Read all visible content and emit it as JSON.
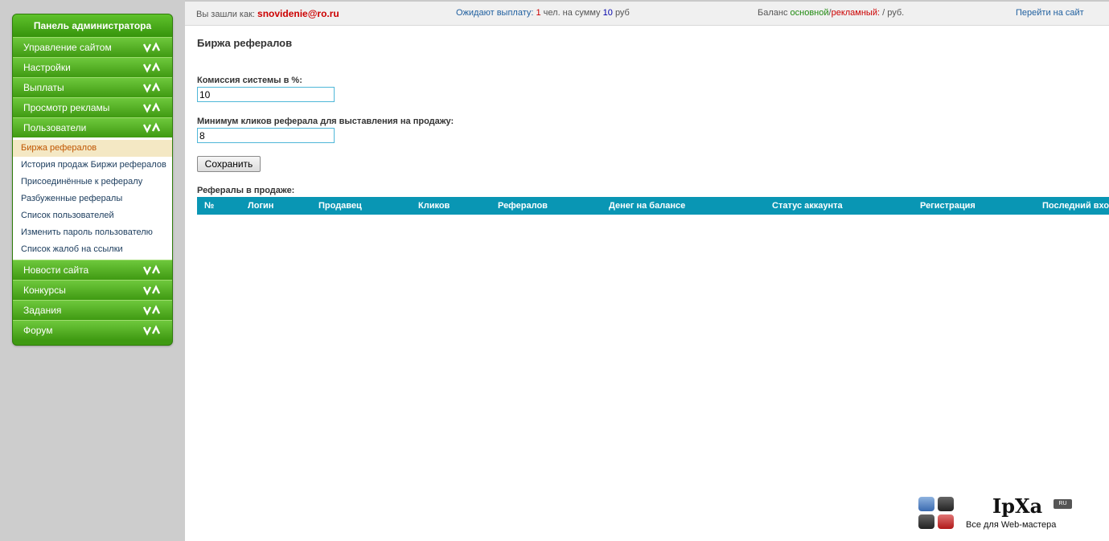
{
  "sidebar": {
    "title": "Панель администратора",
    "sections_top": [
      {
        "label": "Управление сайтом"
      },
      {
        "label": "Настройки"
      },
      {
        "label": "Выплаты"
      },
      {
        "label": "Просмотр рекламы"
      },
      {
        "label": "Пользователи"
      }
    ],
    "sub_items": [
      {
        "label": "Биржа рефералов",
        "active": true
      },
      {
        "label": "История продаж Биржи рефералов"
      },
      {
        "label": "Присоединённые к рефералу"
      },
      {
        "label": "Разбуженные рефералы"
      },
      {
        "label": "Список пользователей"
      },
      {
        "label": "Изменить пароль пользователю"
      },
      {
        "label": "Список жалоб на ссылки"
      }
    ],
    "sections_bottom": [
      {
        "label": "Новости сайта"
      },
      {
        "label": "Конкурсы"
      },
      {
        "label": "Задания"
      },
      {
        "label": "Форум"
      }
    ],
    "toggle_icon": "double-chevron-icon"
  },
  "topbar": {
    "logged_in_prefix": "Вы зашли как:",
    "email": "snovidenie@ro.ru",
    "payout_prefix": "Ожидают выплату:",
    "payout_count": "1",
    "payout_mid": "чел. на сумму",
    "payout_sum": "10",
    "payout_currency": "руб",
    "balance_prefix": "Баланс",
    "balance_main": "основной",
    "balance_sep": "/",
    "balance_ad": "рекламный:",
    "balance_value": "/ руб.",
    "goto_site": "Перейти на сайт"
  },
  "main": {
    "title": "Биржа рефералов",
    "commission_label": "Комиссия системы в %:",
    "commission_value": "10",
    "min_clicks_label": "Минимум кликов реферала для выставления на продажу:",
    "min_clicks_value": "8",
    "save_label": "Сохранить",
    "table_title": "Рефералы в продаже:",
    "columns": [
      "№",
      "Логин",
      "Продавец",
      "Кликов",
      "Рефералов",
      "Денег на балансе",
      "Статус аккаунта",
      "Регистрация",
      "Последний вход"
    ]
  },
  "logo": {
    "name": "IpXa",
    "badge": "RU",
    "tagline": "Все для Web-мастера"
  },
  "colors": {
    "menu_green": "#3f9a12",
    "table_header": "#0996b4",
    "active_item_bg": "#f4e8c4"
  }
}
